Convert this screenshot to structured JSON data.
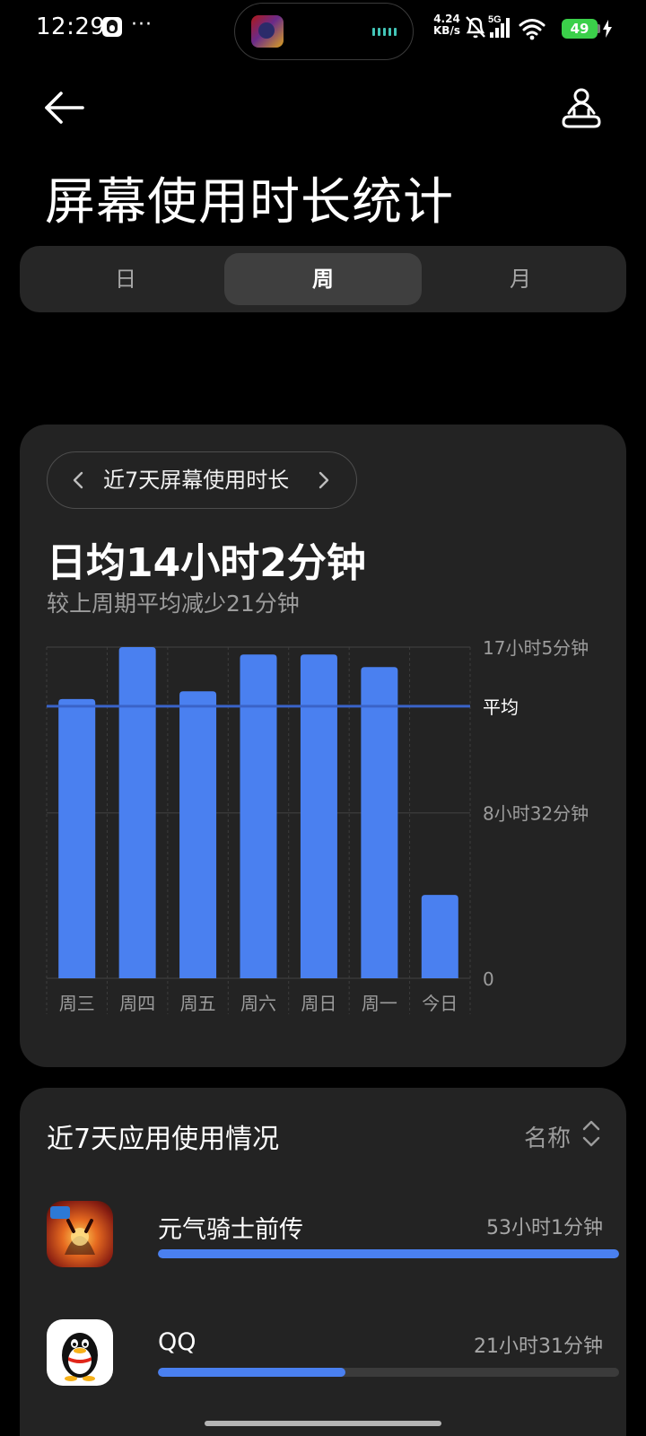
{
  "status_bar": {
    "time": "12:29",
    "dots": "···",
    "net_speed_value": "4.24",
    "net_speed_unit": "KB/s",
    "network": "5G",
    "battery": "49"
  },
  "header": {
    "title": "屏幕使用时长统计"
  },
  "tabs": [
    {
      "label": "日",
      "active": false
    },
    {
      "label": "周",
      "active": true
    },
    {
      "label": "月",
      "active": false
    }
  ],
  "summary": {
    "range_label": "近7天屏幕使用时长",
    "daily_average": "日均14小时2分钟",
    "comparison": "较上周期平均减少21分钟"
  },
  "chart_data": {
    "type": "bar",
    "categories": [
      "周三",
      "周四",
      "周五",
      "周六",
      "周日",
      "周一",
      "今日"
    ],
    "values": [
      14.4,
      17.08,
      14.8,
      16.7,
      16.7,
      16.05,
      4.3
    ],
    "unit": "小时",
    "ylim": [
      0,
      17.08
    ],
    "y_tick_labels": [
      "17小时5分钟",
      "8小时32分钟",
      "0"
    ],
    "y_tick_values": [
      17.08,
      8.53,
      0
    ],
    "average_value": 14.03,
    "average_label": "平均",
    "bar_color": "#4a80f0",
    "average_line_color": "#3a63c8",
    "grid": true
  },
  "apps": {
    "title": "近7天应用使用情况",
    "sort_label": "名称",
    "items": [
      {
        "name": "元气骑士前传",
        "time": "53小时1分钟",
        "share": 1.0,
        "icon": "soul-knight-prequel-icon"
      },
      {
        "name": "QQ",
        "time": "21小时31分钟",
        "share": 0.406,
        "icon": "qq-icon"
      }
    ]
  },
  "colors": {
    "background": "#000000",
    "card": "#232323",
    "accent": "#4a80f0",
    "battery": "#3bd04a"
  }
}
